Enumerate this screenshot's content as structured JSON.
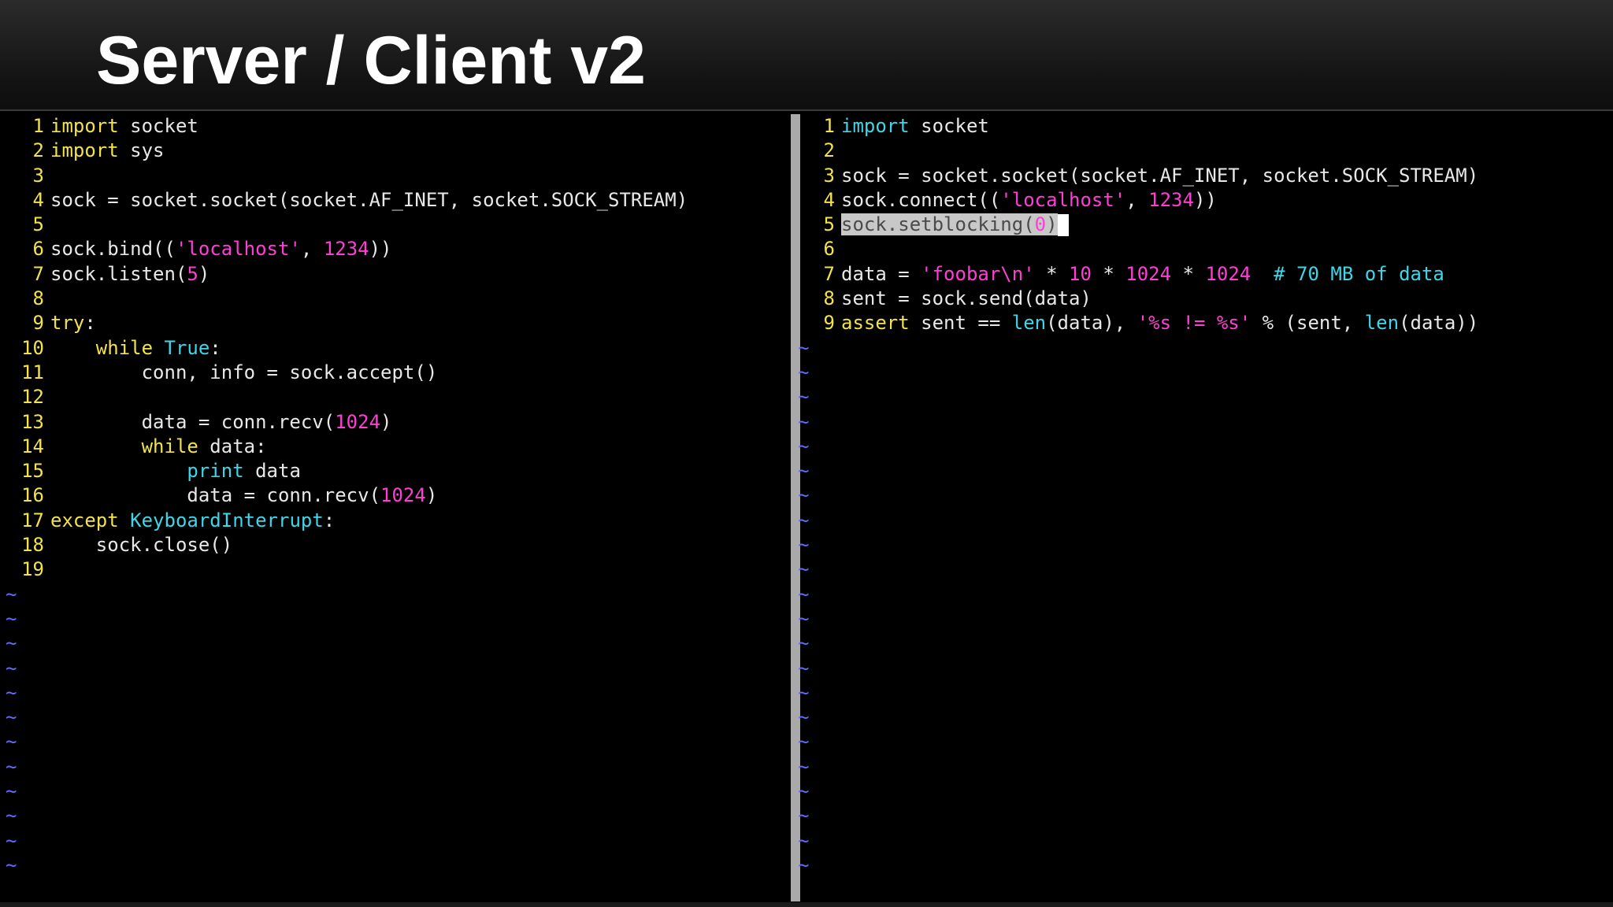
{
  "slide": {
    "title": "Server / Client v2"
  },
  "left_pane": {
    "line_numbers": [
      "1",
      "2",
      "3",
      "4",
      "5",
      "6",
      "7",
      "8",
      "9",
      "10",
      "11",
      "12",
      "13",
      "14",
      "15",
      "16",
      "17",
      "18",
      "19"
    ],
    "tokens": {
      "import": "import",
      "socket": " socket",
      "sys": " sys",
      "sock_assign": "sock = socket.socket(socket.AF_INET, socket.SOCK_STREAM)",
      "bind_pre": "sock.bind((",
      "localhost": "'localhost'",
      "comma": ", ",
      "port": "1234",
      "close_paren2": "))",
      "listen_pre": "sock.listen(",
      "five": "5",
      "close_paren": ")",
      "try": "try",
      "colon": ":",
      "indent4": "    ",
      "indent8": "        ",
      "indent12": "            ",
      "while": "while",
      "true": " True",
      "accept": "conn, info = sock.accept()",
      "recv_pre": "data = conn.recv(",
      "n1024": "1024",
      "data_colon": " data:",
      "print": "print",
      "print_data": " data",
      "except": "except",
      "kbi": " KeyboardInterrupt",
      "close": "sock.close()"
    },
    "tilde": "~"
  },
  "right_pane": {
    "line_numbers": [
      "1",
      "2",
      "3",
      "4",
      "5",
      "6",
      "7",
      "8",
      "9"
    ],
    "tokens": {
      "import": "import",
      "socket": " socket",
      "sock_assign": "sock = socket.socket(socket.AF_INET, socket.SOCK_STREAM)",
      "connect_pre": "sock.connect((",
      "localhost": "'localhost'",
      "comma": ", ",
      "port": "1234",
      "close_paren2": "))",
      "setblocking_pre": "sock.setblocking(",
      "zero": "0",
      "close_paren": ")",
      "data_eq": "data = ",
      "foobar": "'foobar\\n'",
      "times": " * ",
      "ten": "10",
      "n1024": "1024",
      "comment": "  # 70 MB of data",
      "send": "sent = sock.send(data)",
      "assert": "assert",
      "sent_eq": " sent == ",
      "len": "len",
      "data_paren": "(data), ",
      "fmt": "'%s != %s'",
      "mod_sent": " % (sent, ",
      "data_close": "(data))"
    },
    "tilde": "~"
  }
}
